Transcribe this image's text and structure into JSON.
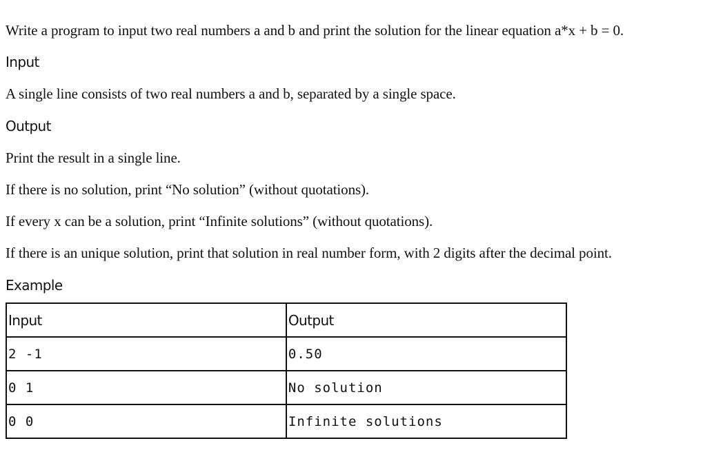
{
  "problem": {
    "statement": "Write a program to input two real numbers a and b and print the solution for the linear equation a*x + b = 0.",
    "input_heading": "Input",
    "input_text": "A single line consists of two real numbers a and b, separated by a single space.",
    "output_heading": "Output",
    "output_lines": [
      "Print the result in a single line.",
      "If there is no solution, print “No solution” (without quotations).",
      "If every x can be a solution, print “Infinite solutions” (without quotations).",
      "If there is an unique solution, print that solution in real number form, with 2 digits after the decimal point."
    ],
    "example_heading": "Example"
  },
  "example_table": {
    "headers": [
      "Input",
      "Output"
    ],
    "rows": [
      {
        "input": "2 -1",
        "output": "0.50"
      },
      {
        "input": "0 1",
        "output": "No solution"
      },
      {
        "input": "0 0",
        "output": "Infinite solutions"
      }
    ]
  }
}
